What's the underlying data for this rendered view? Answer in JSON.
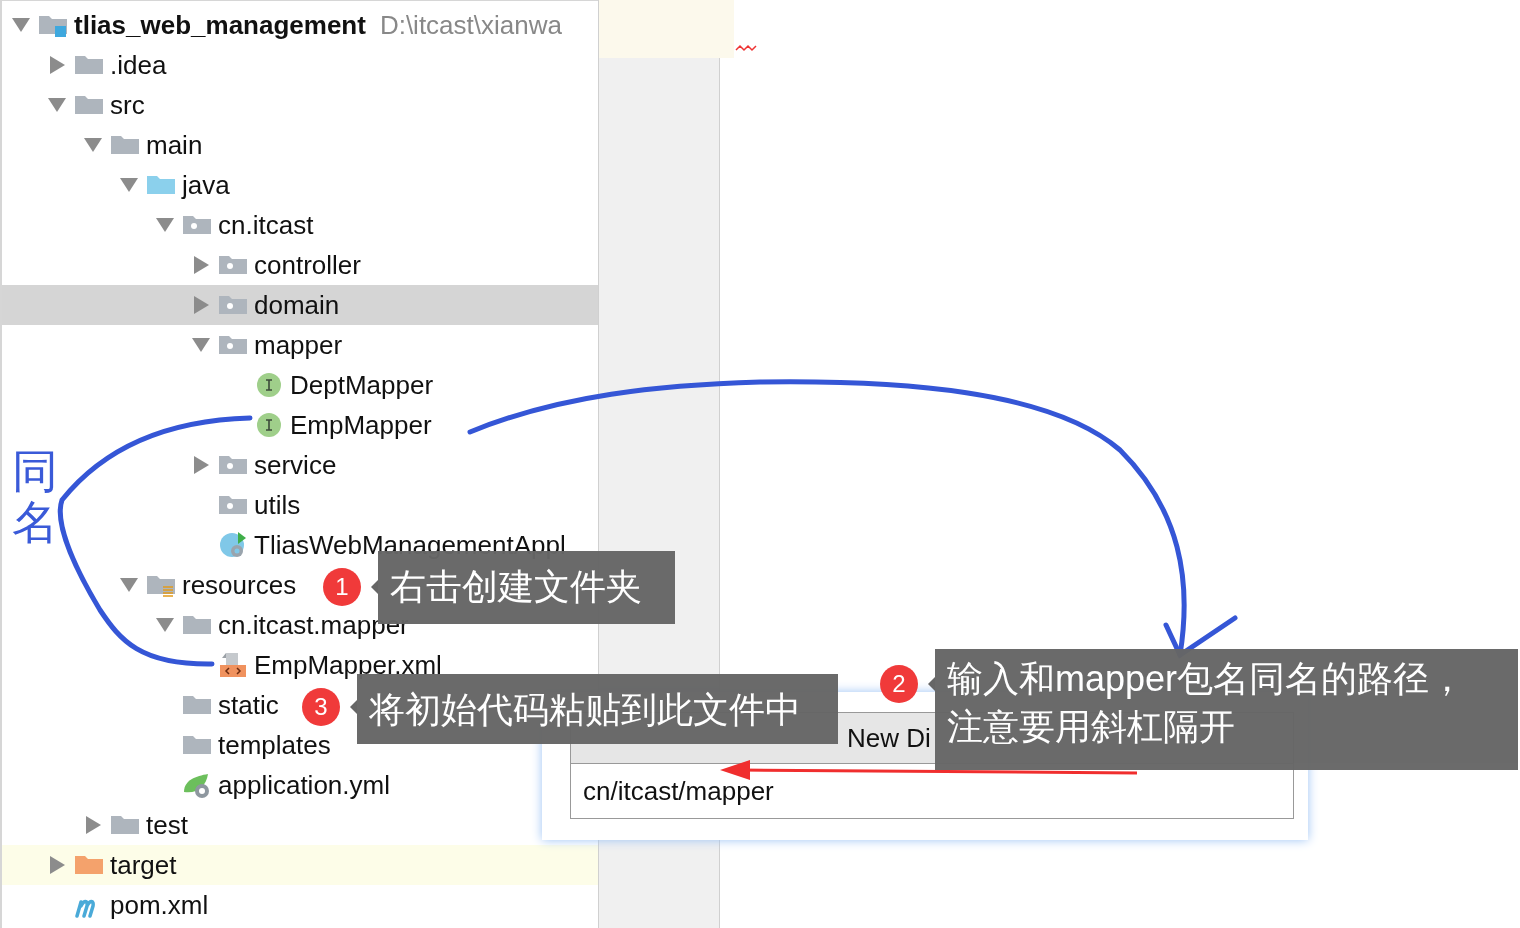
{
  "project_tree": {
    "items": [
      {
        "label": "tlias_web_management",
        "hint": "D:\\itcast\\xianwa",
        "kind": "module",
        "expanded": true,
        "selected": false,
        "excluded": false,
        "children": [
          {
            "label": ".idea",
            "kind": "folder",
            "expanded": false,
            "selected": false,
            "excluded": false
          },
          {
            "label": "src",
            "kind": "folder",
            "expanded": true,
            "selected": false,
            "excluded": false,
            "children": [
              {
                "label": "main",
                "kind": "folder",
                "expanded": true,
                "selected": false,
                "excluded": false,
                "children": [
                  {
                    "label": "java",
                    "kind": "source",
                    "expanded": true,
                    "selected": false,
                    "excluded": false,
                    "children": [
                      {
                        "label": "cn.itcast",
                        "kind": "package",
                        "expanded": true,
                        "selected": false,
                        "excluded": false,
                        "children": [
                          {
                            "label": "controller",
                            "kind": "package",
                            "expanded": false,
                            "selected": false,
                            "excluded": false
                          },
                          {
                            "label": "domain",
                            "kind": "package",
                            "expanded": false,
                            "selected": true,
                            "excluded": false
                          },
                          {
                            "label": "mapper",
                            "kind": "package",
                            "expanded": true,
                            "selected": false,
                            "excluded": false,
                            "children": [
                              {
                                "label": "DeptMapper",
                                "kind": "interface",
                                "selected": false,
                                "excluded": false
                              },
                              {
                                "label": "EmpMapper",
                                "kind": "interface",
                                "selected": false,
                                "excluded": false
                              }
                            ]
                          },
                          {
                            "label": "service",
                            "kind": "package",
                            "expanded": false,
                            "selected": false,
                            "excluded": false
                          },
                          {
                            "label": "utils",
                            "kind": "package",
                            "selected": false,
                            "excluded": false
                          },
                          {
                            "label": "TliasWebManagementAppl",
                            "kind": "spring",
                            "selected": false,
                            "excluded": false
                          }
                        ]
                      }
                    ]
                  },
                  {
                    "label": "resources",
                    "kind": "resources",
                    "expanded": true,
                    "selected": false,
                    "excluded": false,
                    "children": [
                      {
                        "label": "cn.itcast.mapper",
                        "kind": "folder",
                        "expanded": true,
                        "selected": false,
                        "excluded": false,
                        "children": [
                          {
                            "label": "EmpMapper.xml",
                            "kind": "xml",
                            "selected": false,
                            "excluded": false
                          }
                        ]
                      },
                      {
                        "label": "static",
                        "kind": "folder",
                        "selected": false,
                        "excluded": false
                      },
                      {
                        "label": "templates",
                        "kind": "folder",
                        "selected": false,
                        "excluded": false
                      },
                      {
                        "label": "application.yml",
                        "kind": "yml",
                        "selected": false,
                        "excluded": false
                      }
                    ]
                  }
                ]
              },
              {
                "label": "test",
                "kind": "folder",
                "expanded": false,
                "selected": false,
                "excluded": false
              }
            ]
          },
          {
            "label": "target",
            "kind": "excluded",
            "expanded": false,
            "selected": false,
            "excluded": true
          },
          {
            "label": "pom.xml",
            "kind": "maven",
            "selected": false,
            "excluded": false
          }
        ]
      }
    ]
  },
  "dialog": {
    "title": "New Di",
    "value": "cn/itcast/mapper"
  },
  "annotations": {
    "side_label": "同名",
    "callouts": [
      {
        "number": "1",
        "lines": [
          "右击创建文件夹"
        ]
      },
      {
        "number": "3",
        "lines": [
          "将初始代码粘贴到此文件中"
        ]
      },
      {
        "number": "2",
        "lines": [
          "输入和mapper包名同名的路径，",
          "注意要用斜杠隔开"
        ]
      }
    ]
  }
}
